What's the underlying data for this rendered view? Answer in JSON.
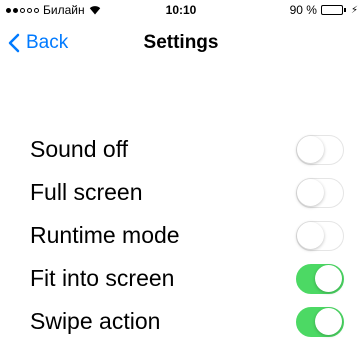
{
  "status_bar": {
    "carrier": "Билайн",
    "signal_dots": 5,
    "signal_filled": 2,
    "time": "10:10",
    "battery_percent": "90 %",
    "battery_level": 0.9
  },
  "nav": {
    "back_label": "Back",
    "title": "Settings"
  },
  "settings": [
    {
      "label": "Sound off",
      "enabled": false
    },
    {
      "label": "Full screen",
      "enabled": false
    },
    {
      "label": "Runtime mode",
      "enabled": false
    },
    {
      "label": "Fit into screen",
      "enabled": true
    },
    {
      "label": "Swipe action",
      "enabled": true
    }
  ],
  "colors": {
    "accent": "#007aff",
    "toggle_on": "#4cd964",
    "toggle_off_border": "#e5e5e5"
  }
}
